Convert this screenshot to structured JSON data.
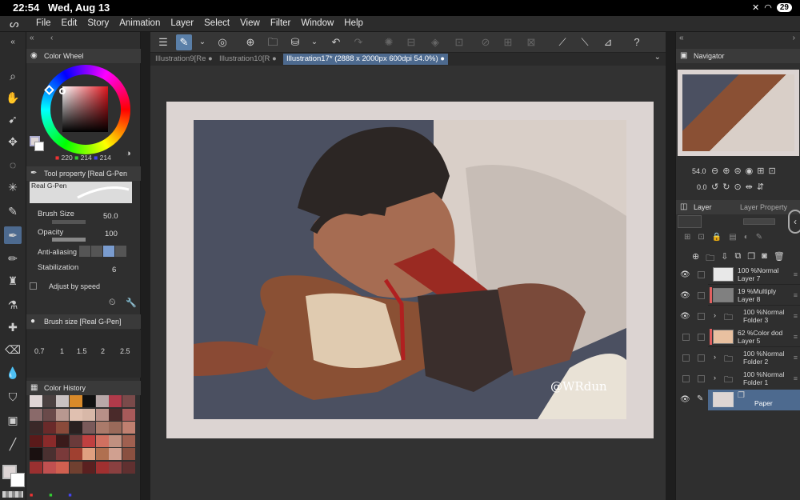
{
  "status": {
    "time": "22:54",
    "date": "Wed, Aug 13",
    "battery": "29"
  },
  "menu": [
    "File",
    "Edit",
    "Story",
    "Animation",
    "Layer",
    "Select",
    "View",
    "Filter",
    "Window",
    "Help"
  ],
  "tabs": [
    {
      "label": "Illustration9[Re"
    },
    {
      "label": "Illustration10[R"
    },
    {
      "label": "Illustration17* (2888 x 2000px 600dpi 54.0%)"
    }
  ],
  "color_wheel": {
    "title": "Color Wheel",
    "r": "220",
    "g": "214",
    "b": "214"
  },
  "tool_property": {
    "title": "Tool property [Real G-Pen",
    "brush_name": "Real G-Pen",
    "brush_size_label": "Brush Size",
    "brush_size": "50.0",
    "opacity_label": "Opacity",
    "opacity": "100",
    "antialias_label": "Anti-aliasing",
    "stabilization_label": "Stabilization",
    "stabilization": "6",
    "adjust_label": "Adjust by speed"
  },
  "brush_size_panel": {
    "title": "Brush size [Real G-Pen]",
    "values": [
      "0.7",
      "1",
      "1.5",
      "2",
      "2.5"
    ]
  },
  "color_history": {
    "title": "Color History",
    "colors": [
      "#e0d6d6",
      "#4a4040",
      "#c9c2c2",
      "#d98a2a",
      "#111111",
      "#b8a8a8",
      "#b03a4a",
      "#7a4a4a",
      "#8a6a6a",
      "#6a4a4a",
      "#b89890",
      "#e0c0b0",
      "#d8b8a8",
      "#b89088",
      "#4a2a2a",
      "#a85a5a",
      "#3a2828",
      "#6a2a2a",
      "#8a4a3a",
      "#2a2020",
      "#7a5a5a",
      "#aa7a6a",
      "#9a6a5a",
      "#c08070",
      "#5a1a1a",
      "#8a2a2a",
      "#3a1a1a",
      "#6a3a3a",
      "#c04040",
      "#d07060",
      "#c09080",
      "#a06050",
      "#1a1010",
      "#4a3030",
      "#7a3a3a",
      "#a04030",
      "#e0a080",
      "#b07050",
      "#d0a090",
      "#8a5040",
      "#9a3030",
      "#c05050",
      "#d06050",
      "#704030",
      "#5a2020",
      "#a03030",
      "#8a4040",
      "#603030"
    ]
  },
  "navigator": {
    "title": "Navigator",
    "zoom": "54.0",
    "angle": "0.0"
  },
  "layer_panel": {
    "tab_layer": "Layer",
    "tab_property": "Layer Property"
  },
  "layers": [
    {
      "opacity_mode": "100 %Normal",
      "name": "Layer 7",
      "visible": true,
      "kind": "raster",
      "thumb": "#e8e8e8"
    },
    {
      "opacity_mode": "19 %Multiply",
      "name": "Layer 8",
      "visible": true,
      "kind": "raster",
      "thumb": "#808080",
      "mark": "#e06060"
    },
    {
      "opacity_mode": "100 %Normal",
      "name": "Folder 3",
      "visible": true,
      "kind": "folder"
    },
    {
      "opacity_mode": "62 %Color dod",
      "name": "Layer 5",
      "visible": false,
      "kind": "raster",
      "thumb": "#e8c0a0",
      "mark": "#e06060"
    },
    {
      "opacity_mode": "100 %Normal",
      "name": "Folder 2",
      "visible": false,
      "kind": "folder"
    },
    {
      "opacity_mode": "100 %Normal",
      "name": "Folder 1",
      "visible": false,
      "kind": "folder"
    },
    {
      "opacity_mode": "",
      "name": "Paper",
      "visible": true,
      "kind": "paper",
      "thumb": "#ddd5d3"
    }
  ],
  "signature": "@WRdun"
}
